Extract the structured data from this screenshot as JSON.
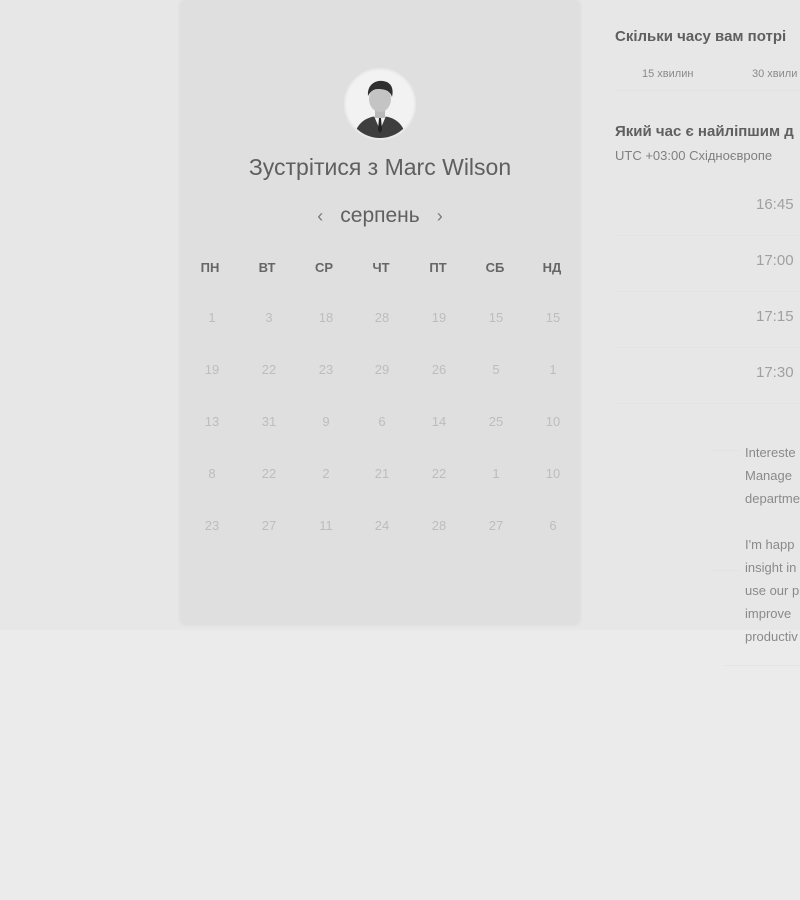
{
  "booking": {
    "title": "Зустрітися з Marc Wilson",
    "month": "серпень",
    "prev_icon": "‹",
    "next_icon": "›"
  },
  "calendar": {
    "weekdays": [
      "ПН",
      "ВТ",
      "СР",
      "ЧТ",
      "ПТ",
      "СБ",
      "НД"
    ],
    "weeks": [
      [
        "1",
        "3",
        "18",
        "28",
        "19",
        "15",
        "15"
      ],
      [
        "19",
        "22",
        "23",
        "29",
        "26",
        "5",
        "1"
      ],
      [
        "13",
        "31",
        "9",
        "6",
        "14",
        "25",
        "10"
      ],
      [
        "8",
        "22",
        "2",
        "21",
        "22",
        "1",
        "10"
      ],
      [
        "23",
        "27",
        "11",
        "24",
        "28",
        "27",
        "6"
      ]
    ]
  },
  "duration": {
    "question": "Скільки часу вам потрі",
    "options": [
      "15 хвилин",
      "30 хвили"
    ]
  },
  "time": {
    "question": "Який час є найліпшим д",
    "timezone": "UTC +03:00 Східноєвропе",
    "slots": [
      "16:45",
      "17:00",
      "17:15",
      "17:30"
    ]
  },
  "description": {
    "paragraph1": [
      "Intereste",
      "Manage",
      "departme"
    ],
    "paragraph2": [
      "I'm happ",
      "insight in",
      "use our p",
      "improve",
      "productiv"
    ]
  }
}
